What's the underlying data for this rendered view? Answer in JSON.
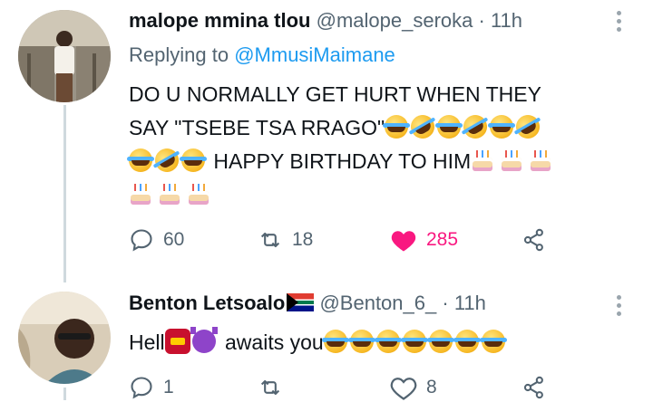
{
  "tweet1": {
    "author_name": "malope mmina tlou",
    "author_handle": "@malope_seroka",
    "separator": "·",
    "time": "11h",
    "replying_to_prefix": "Replying to",
    "replying_to_handle": "@MmusiMaimane",
    "text_line1": "DO U NORMALLY GET HURT WHEN THEY",
    "text_line2": "SAY \"TSEBE TSA RRAGO\"",
    "text_line3": "HAPPY BIRTHDAY TO HIM",
    "reply_count": "60",
    "retweet_count": "18",
    "like_count": "285",
    "liked": true
  },
  "tweet2": {
    "author_name": "Benton Letsoalo",
    "author_handle": "@Benton_6_",
    "separator": "·",
    "time": "11h",
    "text_part1": "Hell",
    "text_part2": "awaits you",
    "reply_count": "1",
    "retweet_count": "",
    "like_count": "8"
  },
  "colors": {
    "text": "#0f1419",
    "muted": "#536471",
    "link": "#1d9bf0",
    "like_active": "#f91880",
    "thread_line": "#cfd9de"
  },
  "icons": [
    "reply-icon",
    "retweet-icon",
    "heart-icon",
    "share-icon",
    "more-icon",
    "face-with-tears-of-joy-emoji",
    "rolling-on-floor-laughing-emoji",
    "birthday-cake-emoji",
    "ogre-emoji",
    "smiling-devil-emoji",
    "south-africa-flag-emoji"
  ]
}
